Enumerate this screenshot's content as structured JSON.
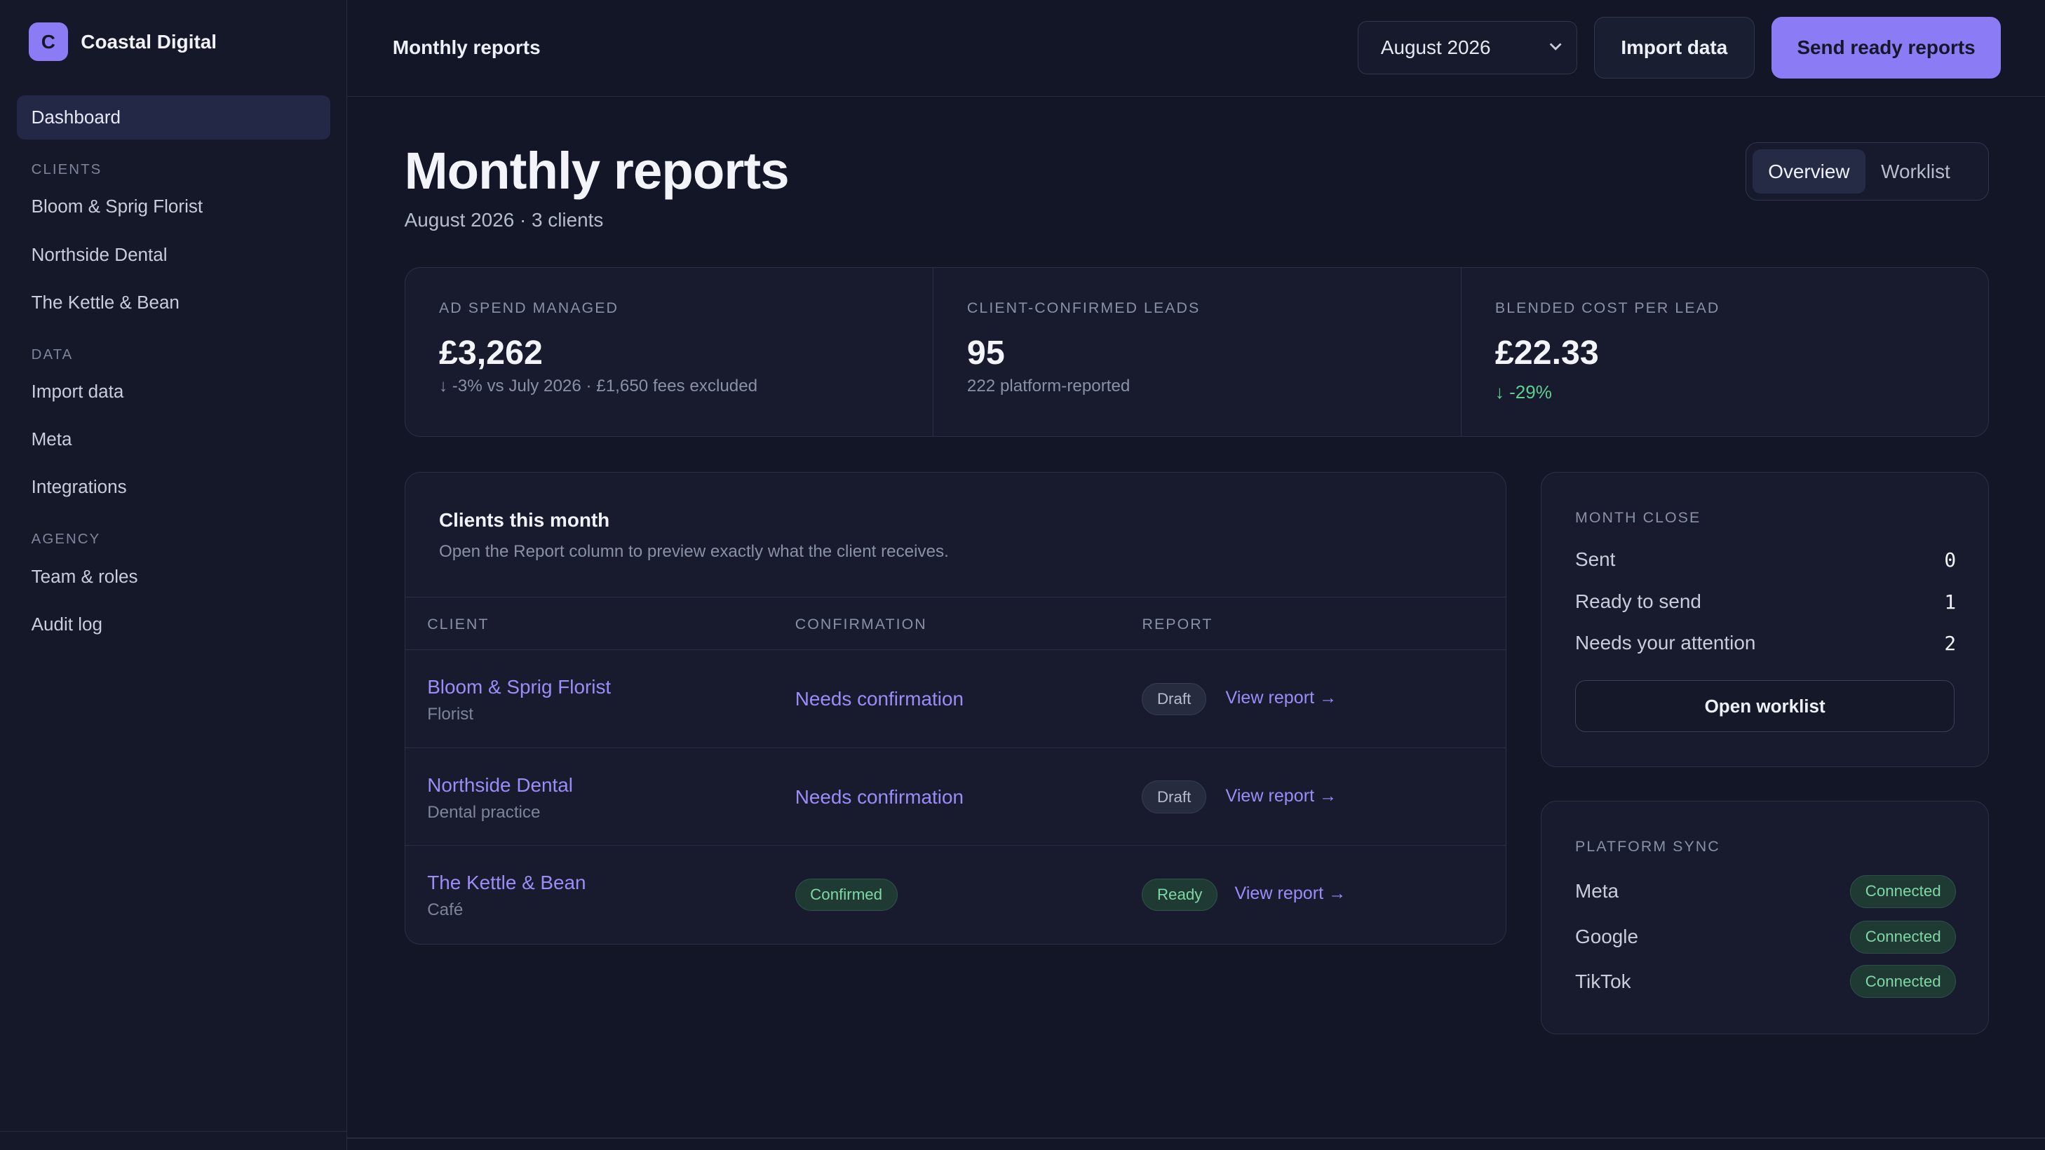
{
  "brand": {
    "logo_letter": "C",
    "name": "Coastal Digital"
  },
  "sidebar": {
    "dashboard": "Dashboard",
    "sections": [
      {
        "title": "CLIENTS",
        "items": [
          "Bloom & Sprig Florist",
          "Northside Dental",
          "The Kettle & Bean"
        ]
      },
      {
        "title": "DATA",
        "items": [
          "Import data",
          "Meta",
          "Integrations"
        ]
      },
      {
        "title": "AGENCY",
        "items": [
          "Team & roles",
          "Audit log"
        ]
      }
    ]
  },
  "topbar": {
    "title": "Monthly reports",
    "month_select": "August 2026",
    "import_label": "Import data",
    "send_label": "Send ready reports"
  },
  "page": {
    "title": "Monthly reports",
    "subtitle": "August 2026 · 3 clients",
    "tabs": [
      "Overview",
      "Worklist"
    ]
  },
  "kpis": [
    {
      "label": "AD SPEND MANAGED",
      "value": "£3,262",
      "sub": "↓ -3% vs July 2026 · £1,650 fees excluded"
    },
    {
      "label": "CLIENT-CONFIRMED LEADS",
      "value": "95",
      "sub": "222 platform-reported"
    },
    {
      "label": "BLENDED COST PER LEAD",
      "value": "£22.33",
      "sub": "↓ -29%"
    }
  ],
  "clients_card": {
    "title": "Clients this month",
    "subtitle": "Open the Report column to preview exactly what the client receives.",
    "columns": [
      "CLIENT",
      "CONFIRMATION",
      "REPORT"
    ],
    "rows": [
      {
        "name": "Bloom & Sprig Florist",
        "type": "Florist",
        "confirmation": "Needs confirmation",
        "status": "Draft",
        "link": "View report →"
      },
      {
        "name": "Northside Dental",
        "type": "Dental practice",
        "confirmation": "Needs confirmation",
        "status": "Draft",
        "link": "View report →"
      },
      {
        "name": "The Kettle & Bean",
        "type": "Café",
        "confirmation": "Confirmed",
        "status": "Ready",
        "link": "View report →"
      }
    ]
  },
  "month_close": {
    "title": "MONTH CLOSE",
    "rows": [
      {
        "label": "Sent",
        "value": "0"
      },
      {
        "label": "Ready to send",
        "value": "1"
      },
      {
        "label": "Needs your attention",
        "value": "2"
      }
    ],
    "button": "Open worklist"
  },
  "platform_sync": {
    "title": "PLATFORM SYNC",
    "rows": [
      {
        "name": "Meta",
        "status": "Connected"
      },
      {
        "name": "Google",
        "status": "Connected"
      },
      {
        "name": "TikTok",
        "status": "Connected"
      }
    ]
  },
  "colors": {
    "accent": "#8b7cf6",
    "link": "#9b8cf8",
    "success": "#5fcf8e",
    "background": "#121627"
  }
}
